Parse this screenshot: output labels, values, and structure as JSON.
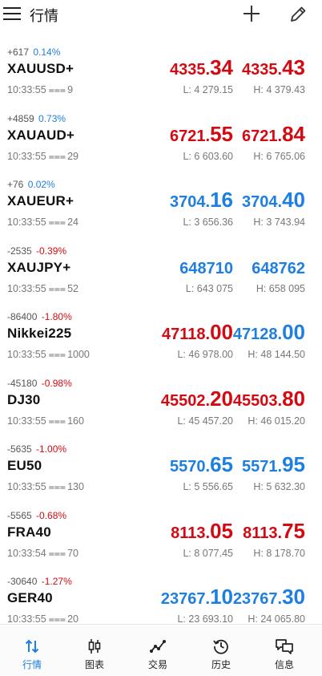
{
  "header": {
    "title": "行情",
    "menu_icon": "hamburger-menu-icon",
    "add_icon": "plus-icon",
    "edit_icon": "pencil-icon"
  },
  "colors": {
    "red": "#d40a12",
    "blue": "#1e7fe0",
    "gray": "#777777"
  },
  "quotes": [
    {
      "change_pts": "+617",
      "change_pct": "0.14%",
      "symbol": "XAUUSD+",
      "time": "10:33:55",
      "spread": "9",
      "bid_main": "4335.",
      "bid_big": "34",
      "ask_main": "4335.",
      "ask_big": "43",
      "low": "L: 4 279.15",
      "high": "H: 4 379.43"
    },
    {
      "change_pts": "+4859",
      "change_pct": "0.73%",
      "symbol": "XAUAUD+",
      "time": "10:33:55",
      "spread": "29",
      "bid_main": "6721.",
      "bid_big": "55",
      "ask_main": "6721.",
      "ask_big": "84",
      "low": "L: 6 603.60",
      "high": "H: 6 765.06"
    },
    {
      "change_pts": "+76",
      "change_pct": "0.02%",
      "symbol": "XAUEUR+",
      "time": "10:33:55",
      "spread": "24",
      "bid_main": "3704.",
      "bid_big": "16",
      "ask_main": "3704.",
      "ask_big": "40",
      "low": "L: 3 656.36",
      "high": "H: 3 743.94"
    },
    {
      "change_pts": "-2535",
      "change_pct": "-0.39%",
      "symbol": "XAUJPY+",
      "time": "10:33:55",
      "spread": "52",
      "bid_main": "648710",
      "bid_big": "",
      "ask_main": "648762",
      "ask_big": "",
      "low": "L: 643 075",
      "high": "H: 658 095"
    },
    {
      "change_pts": "-86400",
      "change_pct": "-1.80%",
      "symbol": "Nikkei225",
      "time": "10:33:55",
      "spread": "1000",
      "bid_main": "47118.",
      "bid_big": "00",
      "ask_main": "47128.",
      "ask_big": "00",
      "low": "L: 46 978.00",
      "high": "H: 48 144.50"
    },
    {
      "change_pts": "-45180",
      "change_pct": "-0.98%",
      "symbol": "DJ30",
      "time": "10:33:55",
      "spread": "160",
      "bid_main": "45502.",
      "bid_big": "20",
      "ask_main": "45503.",
      "ask_big": "80",
      "low": "L: 45 457.20",
      "high": "H: 46 015.20"
    },
    {
      "change_pts": "-5635",
      "change_pct": "-1.00%",
      "symbol": "EU50",
      "time": "10:33:55",
      "spread": "130",
      "bid_main": "5570.",
      "bid_big": "65",
      "ask_main": "5571.",
      "ask_big": "95",
      "low": "L: 5 556.65",
      "high": "H: 5 632.30"
    },
    {
      "change_pts": "-5565",
      "change_pct": "-0.68%",
      "symbol": "FRA40",
      "time": "10:33:54",
      "spread": "70",
      "bid_main": "8113.",
      "bid_big": "05",
      "ask_main": "8113.",
      "ask_big": "75",
      "low": "L: 8 077.45",
      "high": "H: 8 178.70"
    },
    {
      "change_pts": "-30640",
      "change_pct": "-1.27%",
      "symbol": "GER40",
      "time": "10:33:55",
      "spread": "20",
      "bid_main": "23767.",
      "bid_big": "10",
      "ask_main": "23767.",
      "ask_big": "30",
      "low": "L: 23 693.10",
      "high": "H: 24 065.80"
    }
  ],
  "tabs": [
    {
      "label": "行情",
      "icon": "quotes-arrows-icon"
    },
    {
      "label": "图表",
      "icon": "candlestick-chart-icon"
    },
    {
      "label": "交易",
      "icon": "trade-line-icon"
    },
    {
      "label": "历史",
      "icon": "history-clock-icon"
    },
    {
      "label": "信息",
      "icon": "messages-icon"
    }
  ]
}
